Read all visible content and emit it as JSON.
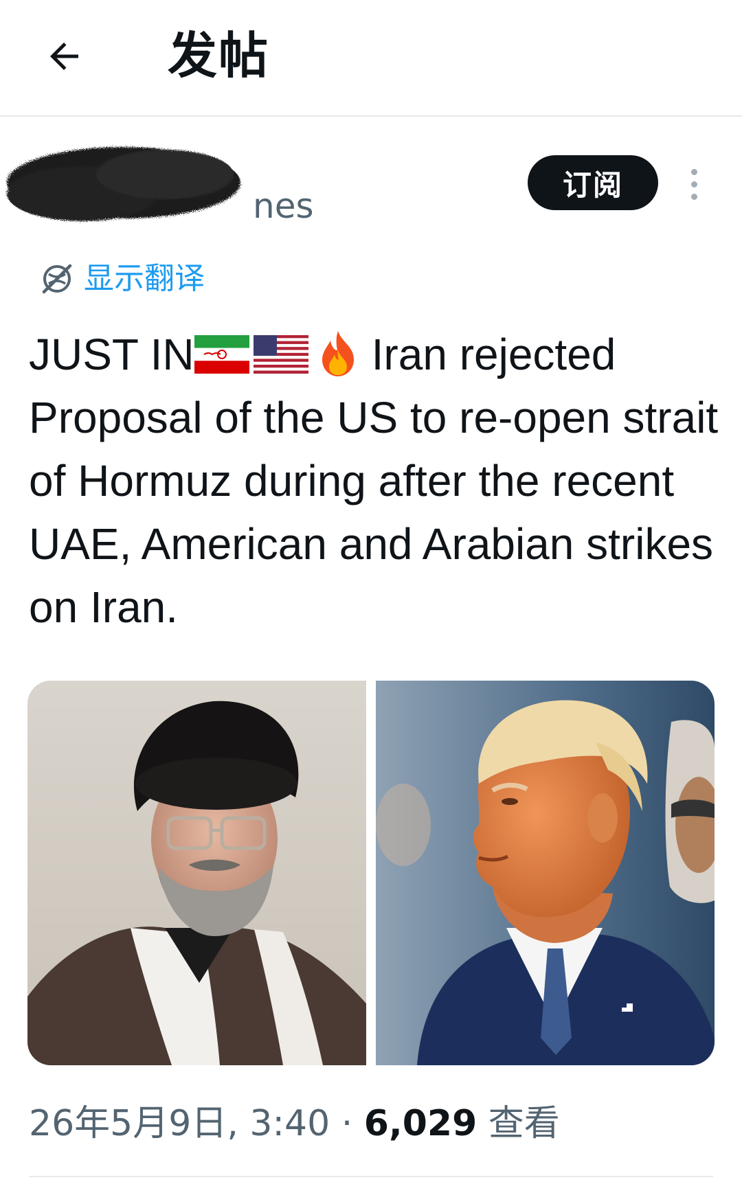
{
  "header": {
    "title": "发帖",
    "back_icon": "arrow-left-icon"
  },
  "author": {
    "handle_fragment": "nes",
    "subscribe_label": "订阅",
    "more_icon": "vertical-ellipsis-icon"
  },
  "translate": {
    "label": "显示翻译",
    "icon": "translate-globe-icon"
  },
  "tweet": {
    "prefix": "JUST IN",
    "emojis": [
      "iran-flag",
      "us-flag",
      "fire"
    ],
    "text_line1_rest": "Iran rejected",
    "text_rest": "Proposal of the US to re-open strait of Hormuz during after the recent UAE, American and Arabian strikes on Iran."
  },
  "media": {
    "items": [
      "photo-cleric",
      "photo-politician"
    ]
  },
  "meta": {
    "timestamp": "26年5月9日, 3:40",
    "separator": " · ",
    "views_count": "6,029",
    "views_label": "查看"
  },
  "colors": {
    "text": "#0f1419",
    "secondary": "#536471",
    "link": "#1d9bf0",
    "divider": "#e7e9ea"
  }
}
